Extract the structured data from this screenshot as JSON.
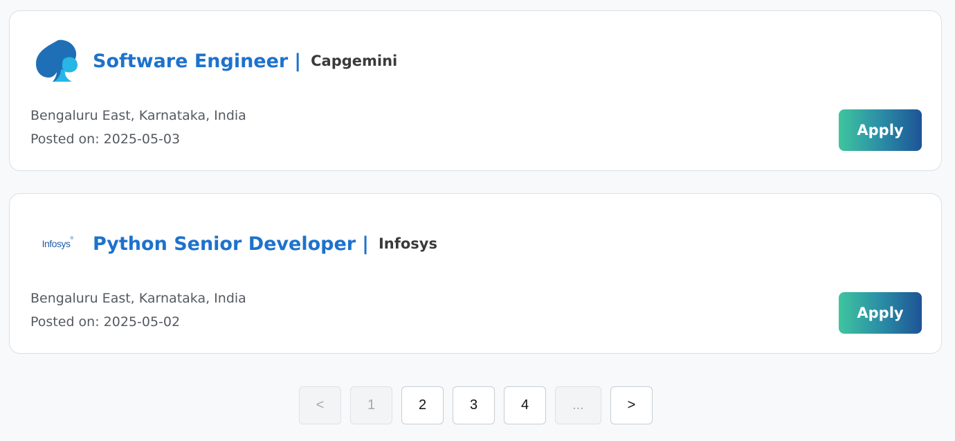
{
  "jobs": [
    {
      "title": "Software Engineer",
      "separator": "|",
      "company": "Capgemini",
      "location": "Bengaluru East, Karnataka, India",
      "posted": "Posted on: 2025-05-03",
      "apply_label": "Apply",
      "logo_icon": "capgemini-spade-logo",
      "logo_colors": [
        "#1f6fb6",
        "#27b6e6"
      ]
    },
    {
      "title": "Python Senior Developer",
      "separator": "|",
      "company": "Infosys",
      "location": "Bengaluru East, Karnataka, India",
      "posted": "Posted on: 2025-05-02",
      "apply_label": "Apply",
      "logo_text": "Infosys",
      "logo_mark": "®",
      "logo_color": "#1f5ea8"
    }
  ],
  "pagination": {
    "prev": "<",
    "pages": [
      "1",
      "2",
      "3",
      "4"
    ],
    "current": "1",
    "ellipsis": "...",
    "next": ">"
  },
  "colors": {
    "title": "#1d72cc",
    "apply_gradient_start": "#3ec59e",
    "apply_gradient_end": "#1d5496",
    "background": "#f7f9fa"
  }
}
